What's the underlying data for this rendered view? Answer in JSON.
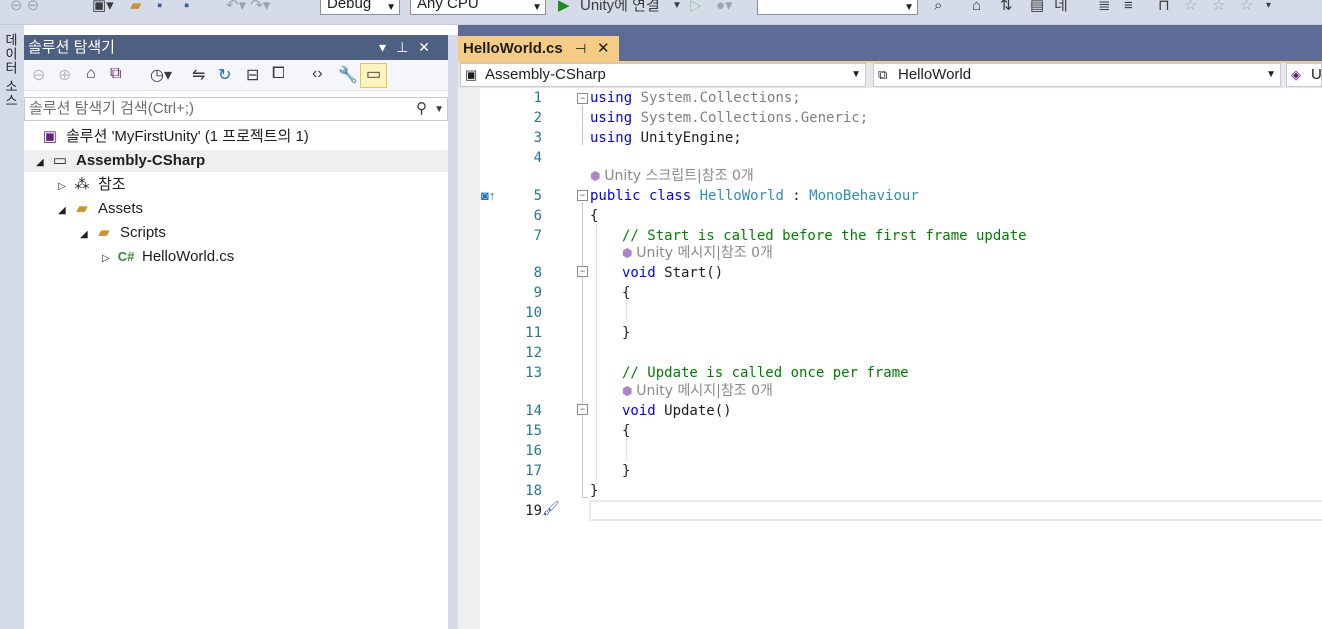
{
  "toolbar": {
    "config": "Debug",
    "platform": "Any CPU",
    "run_label": "Unity에 연결",
    "search_value": "",
    "extra_label": "네"
  },
  "side_strip": {
    "tab_label": "데이터 소스"
  },
  "solution_explorer": {
    "title": "솔루션 탐색기",
    "search_placeholder": "솔루션 탐색기 검색(Ctrl+;)",
    "tree": {
      "solution": "솔루션 'MyFirstUnity' (1 프로젝트의 1)",
      "project": "Assembly-CSharp",
      "references": "참조",
      "assets": "Assets",
      "scripts": "Scripts",
      "file": "HelloWorld.cs"
    }
  },
  "editor": {
    "tab_title": "HelloWorld.cs",
    "nav_project": "Assembly-CSharp",
    "nav_class": "HelloWorld",
    "nav_member": "U",
    "line_numbers": [
      "1",
      "2",
      "3",
      "4",
      "5",
      "6",
      "7",
      "8",
      "9",
      "10",
      "11",
      "12",
      "13",
      "14",
      "15",
      "16",
      "17",
      "18",
      "19"
    ],
    "lines": {
      "l1_kw": "using",
      "l1_ns": " System.Collections;",
      "l2_kw": "using",
      "l2_ns": " System.Collections.Generic;",
      "l3_kw": "using",
      "l3_ns": " UnityEngine;",
      "lens_class": "Unity 스크립트|참조 0개",
      "l5_kw": "public class",
      "l5_name": " HelloWorld",
      "l5_colon": " : ",
      "l5_base": "MonoBehaviour",
      "l6": "{",
      "l7": "// Start is called before the first frame update",
      "lens_start": "Unity 메시지|참조 0개",
      "l8_kw": "void",
      "l8_name": " Start()",
      "l9": "{",
      "l11": "}",
      "l13": "// Update is called once per frame",
      "lens_update": "Unity 메시지|참조 0개",
      "l14_kw": "void",
      "l14_name": " Update()",
      "l15": "{",
      "l17": "}",
      "l18": "}"
    }
  }
}
